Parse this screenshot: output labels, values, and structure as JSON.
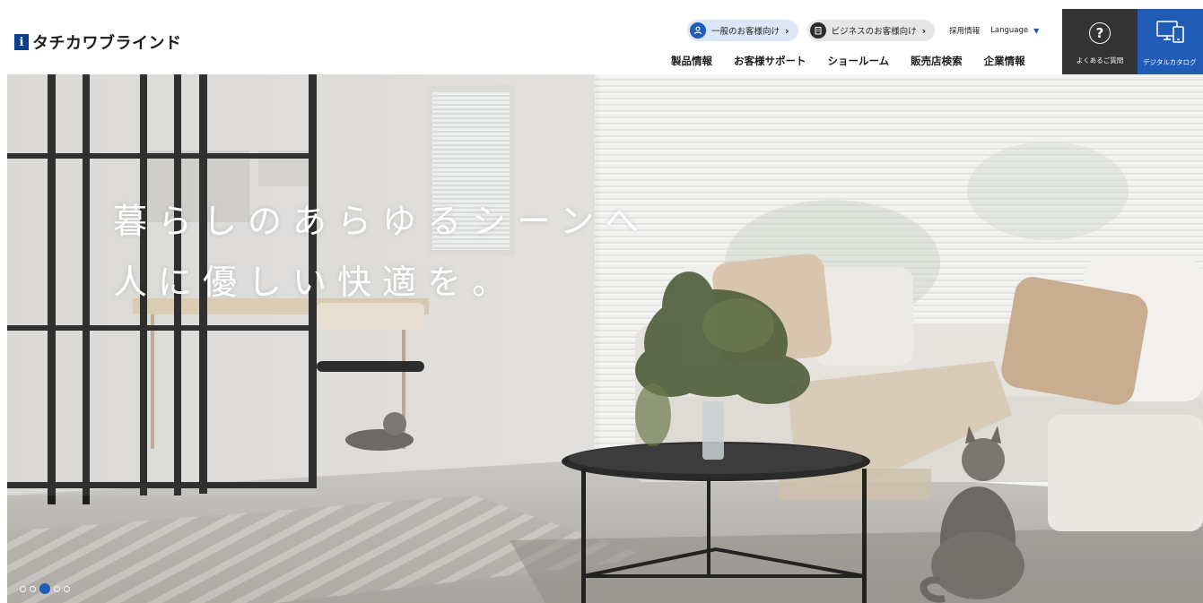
{
  "header": {
    "logo_mark": "i",
    "logo_text": "タチカワブラインド",
    "utility": {
      "personal_label": "一般のお客様向け",
      "business_label": "ビジネスのお客様向け",
      "recruit_label": "採用情報",
      "language_label": "Language"
    },
    "nav": [
      {
        "label": "製品情報"
      },
      {
        "label": "お客様サポート"
      },
      {
        "label": "ショールーム"
      },
      {
        "label": "販売店検索"
      },
      {
        "label": "企業情報"
      }
    ],
    "faq_label": "よくあるご質問",
    "catalog_label": "デジタルカタログ"
  },
  "hero": {
    "line1": "暮らしのあらゆるシーンへ",
    "line2": "人に優しい快適を。",
    "slide_count": 5,
    "active_slide": 3
  },
  "colors": {
    "brand_blue": "#1f5bb7",
    "faq_bg": "#333333",
    "personal_pill": "#dbe7f6",
    "business_pill": "#e6e6e6"
  },
  "icons": {
    "personal": "person-icon",
    "business": "building-icon",
    "faq": "question-icon",
    "catalog": "monitor-icon",
    "language": "chevron-down-icon"
  }
}
